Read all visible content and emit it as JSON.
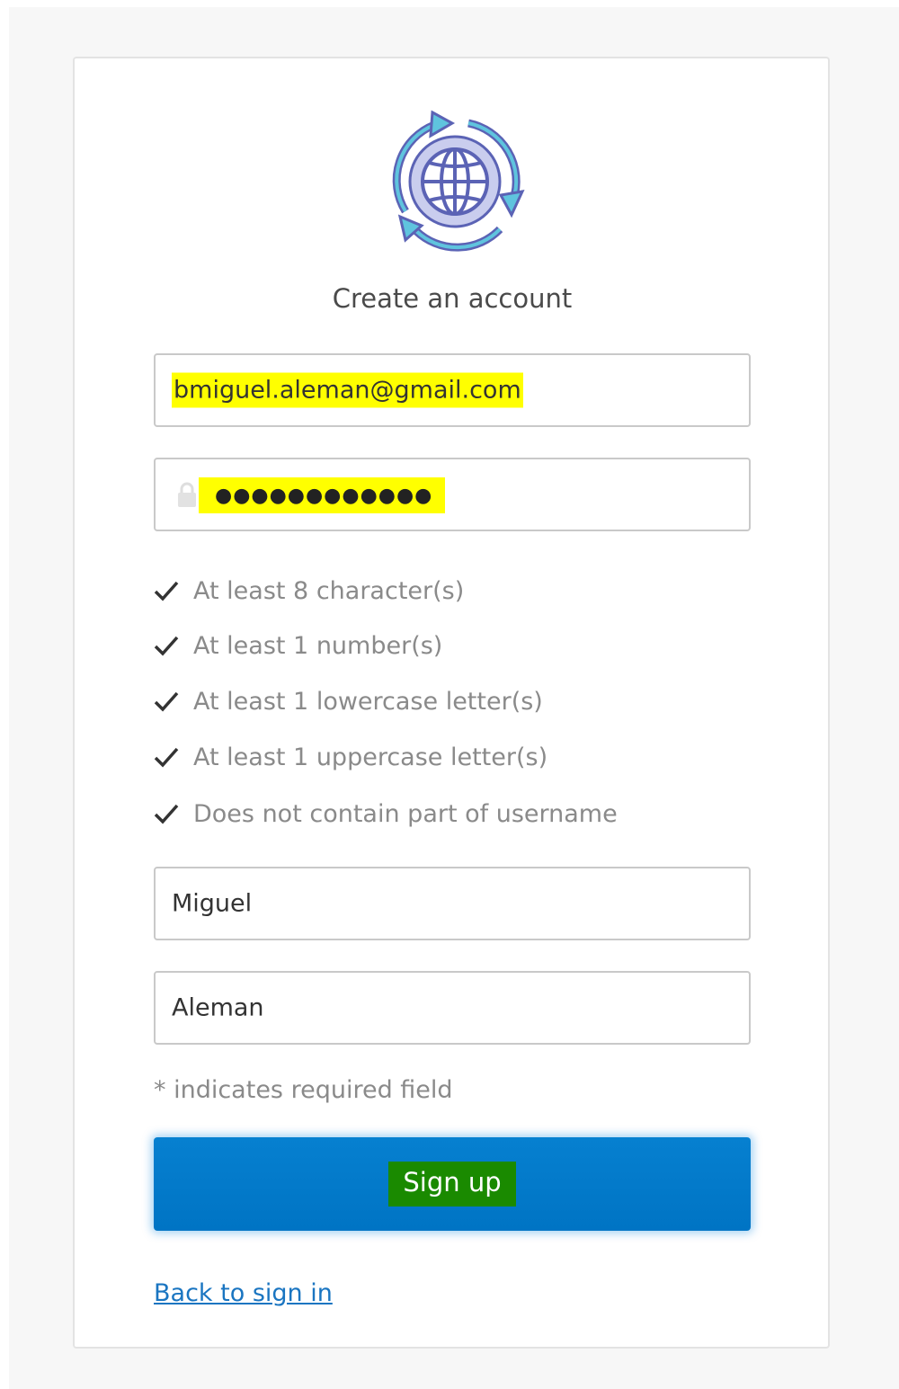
{
  "header": {
    "logo_icon": "globe-sync-icon",
    "title": "Create an account"
  },
  "form": {
    "email_value": "bmiguel.aleman@gmail.com",
    "password_mask": "●●●●●●●●●●●●",
    "first_name_value": "Miguel",
    "last_name_value": "Aleman"
  },
  "password_rules": [
    {
      "label": "At least 8 character(s)",
      "satisfied": true
    },
    {
      "label": "At least 1 number(s)",
      "satisfied": true
    },
    {
      "label": "At least 1 lowercase letter(s)",
      "satisfied": true
    },
    {
      "label": "At least 1 uppercase letter(s)",
      "satisfied": true
    },
    {
      "label": "Does not contain part of username",
      "satisfied": true
    }
  ],
  "required_note": "* indicates required field",
  "actions": {
    "signup_label": "Sign up",
    "back_link": "Back to sign in"
  },
  "colors": {
    "button_blue": "#007dc8",
    "link_blue": "#1a75c1",
    "text_highlight_yellow": "#ffff00",
    "button_highlight_green": "#1a8a00"
  }
}
